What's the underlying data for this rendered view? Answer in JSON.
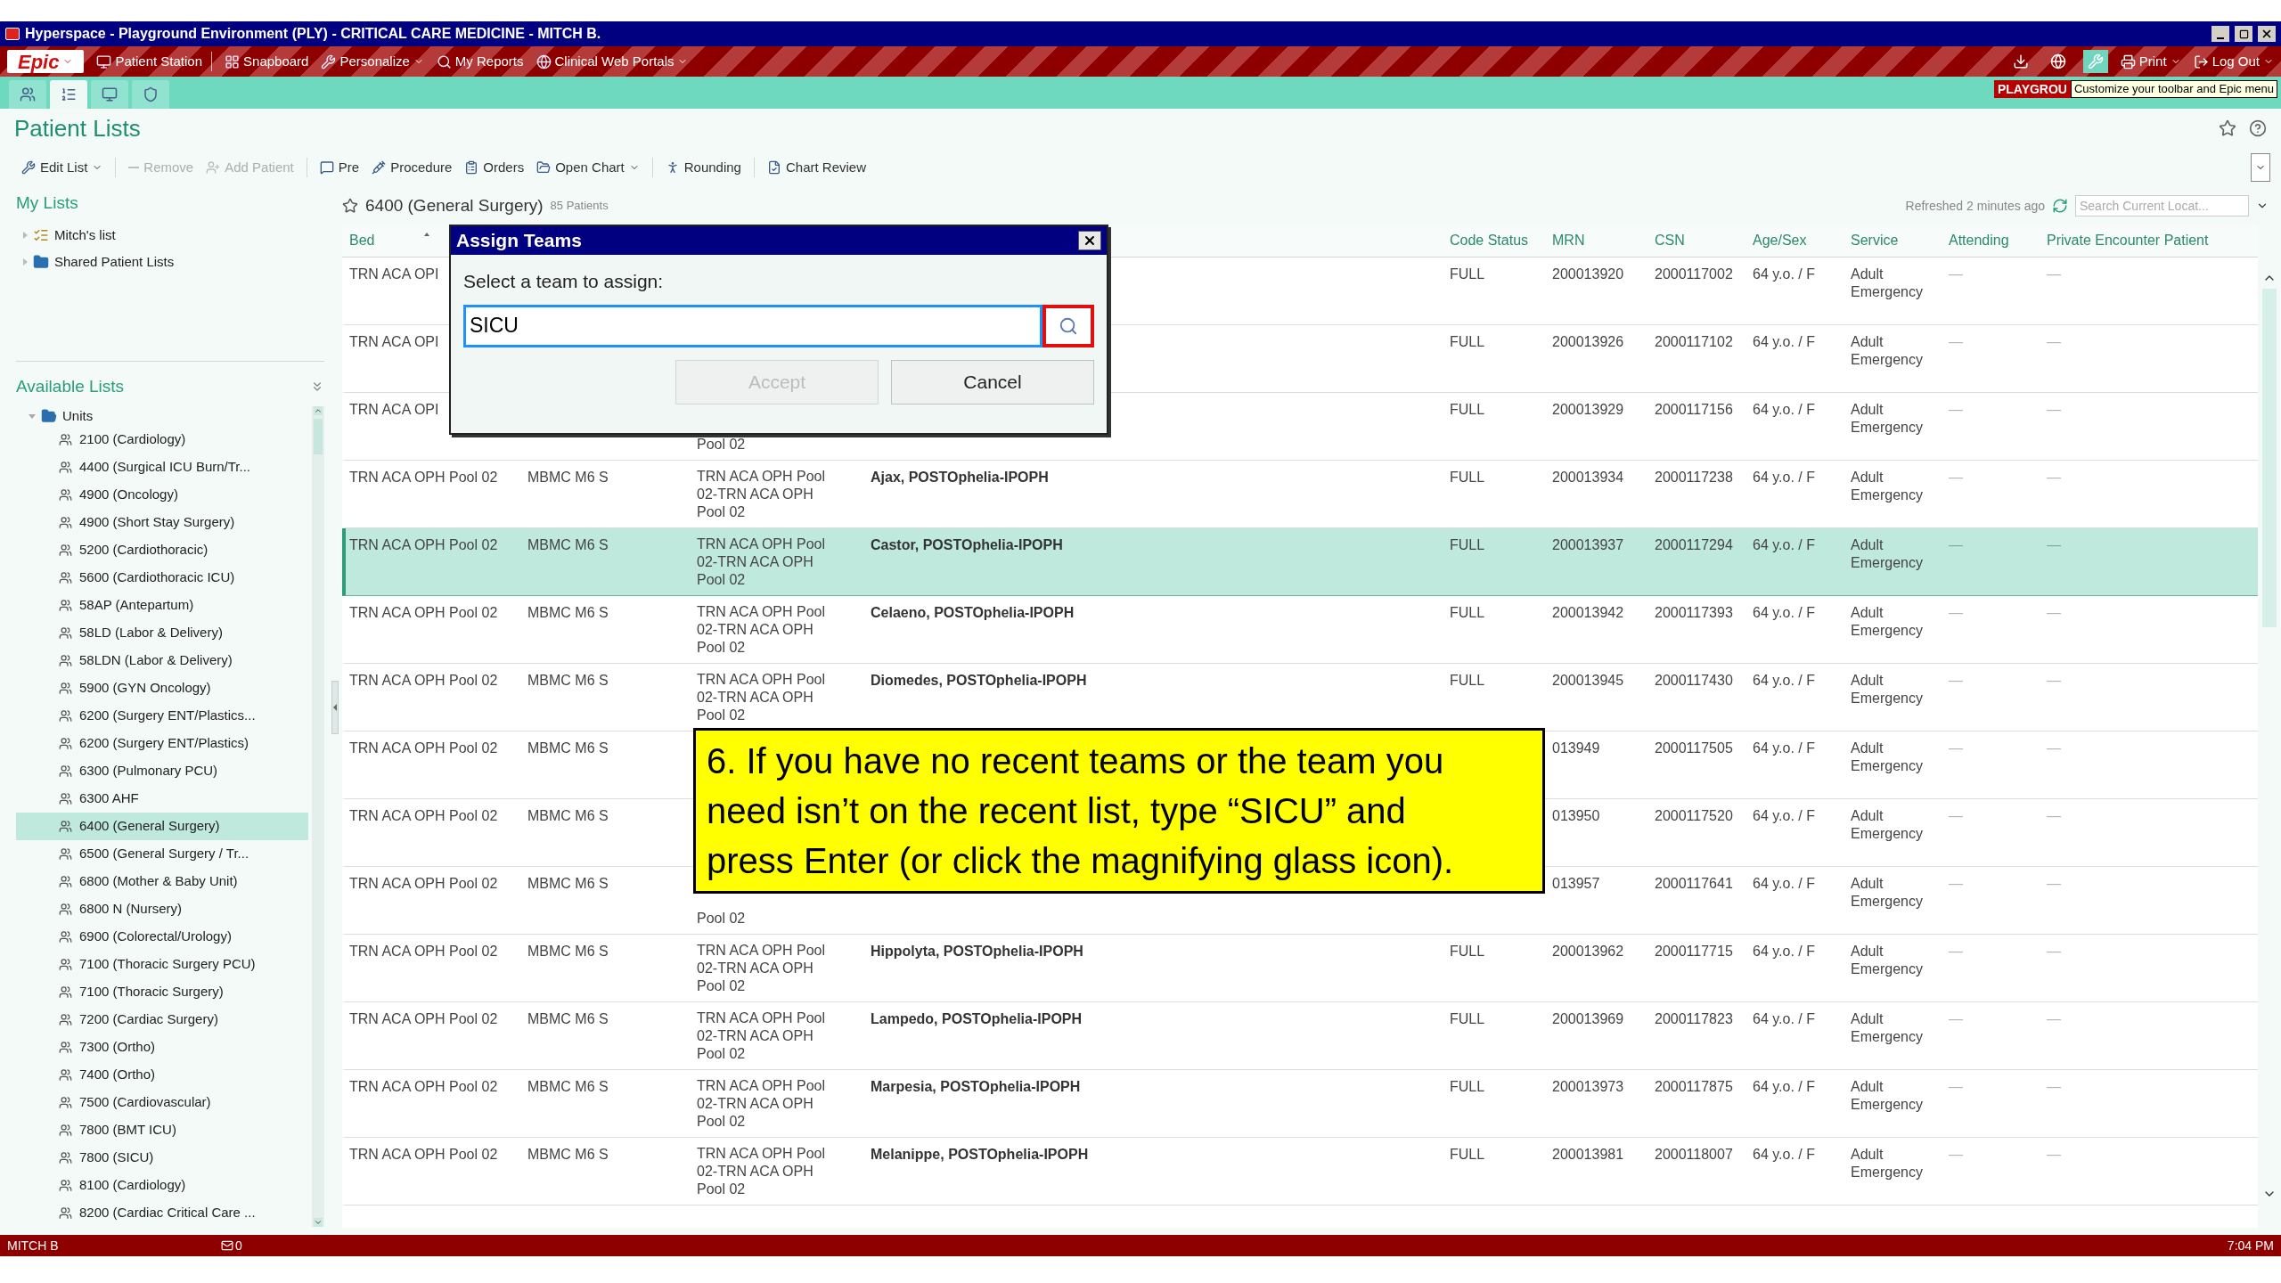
{
  "window": {
    "title": "Hyperspace - Playground Environment (PLY) - CRITICAL CARE MEDICINE - MITCH B."
  },
  "menu_bar": {
    "logo": "Epic",
    "items": [
      {
        "label": "Patient Station",
        "dropdown": false,
        "separator_after": true
      },
      {
        "label": "Snapboard",
        "dropdown": false,
        "separator_after": false
      },
      {
        "label": "Personalize",
        "dropdown": true,
        "separator_after": false
      },
      {
        "label": "My Reports",
        "dropdown": false,
        "separator_after": false
      },
      {
        "label": "Clinical Web Portals",
        "dropdown": true,
        "separator_after": false
      }
    ],
    "icon_buttons": [
      {
        "highlighted": false
      },
      {
        "highlighted": false
      },
      {
        "highlighted": true
      }
    ],
    "right_items": [
      {
        "label": "Print",
        "dropdown": true
      },
      {
        "label": "Log Out",
        "dropdown": true
      }
    ]
  },
  "activity_tabs": [
    {
      "selected": false
    },
    {
      "selected": true
    },
    {
      "selected": false
    },
    {
      "selected": false
    }
  ],
  "environment_badge": "PLAYGROU",
  "tooltip": "Customize your toolbar and Epic menu",
  "page_title": "Patient Lists",
  "toolbar": [
    {
      "label": "Edit List",
      "dropdown": true,
      "disabled": false,
      "separator_before": false
    },
    {
      "label": "Remove",
      "dropdown": false,
      "disabled": true,
      "separator_before": true
    },
    {
      "label": "Add Patient",
      "dropdown": false,
      "disabled": true,
      "separator_before": false
    },
    {
      "label": "Pre",
      "dropdown": false,
      "disabled": false,
      "separator_before": true
    },
    {
      "label": "Procedure",
      "dropdown": false,
      "disabled": false,
      "separator_before": false
    },
    {
      "label": "Orders",
      "dropdown": false,
      "disabled": false,
      "separator_before": false
    },
    {
      "label": "Open Chart",
      "dropdown": true,
      "disabled": false,
      "separator_before": false
    },
    {
      "label": "Rounding",
      "dropdown": false,
      "disabled": false,
      "separator_before": true
    },
    {
      "label": "Chart Review",
      "dropdown": false,
      "disabled": false,
      "separator_before": true
    }
  ],
  "sidebar": {
    "my_lists": {
      "title": "My Lists",
      "items": [
        {
          "label": "Mitch's list",
          "kind": "list",
          "expanded": false
        },
        {
          "label": "Shared Patient Lists",
          "kind": "folder",
          "expanded": false
        }
      ]
    },
    "available_lists": {
      "title": "Available Lists",
      "tree": [
        {
          "label": "Units",
          "expanded": true,
          "children": [
            {
              "label": "2100 (Cardiology)",
              "selected": false
            },
            {
              "label": "4400 (Surgical ICU Burn/Tr...",
              "selected": false
            },
            {
              "label": "4900 (Oncology)",
              "selected": false
            },
            {
              "label": "4900 (Short Stay Surgery)",
              "selected": false
            },
            {
              "label": "5200 (Cardiothoracic)",
              "selected": false
            },
            {
              "label": "5600 (Cardiothoracic ICU)",
              "selected": false
            },
            {
              "label": "58AP (Antepartum)",
              "selected": false
            },
            {
              "label": "58LD (Labor & Delivery)",
              "selected": false
            },
            {
              "label": "58LDN (Labor & Delivery)",
              "selected": false
            },
            {
              "label": "5900 (GYN Oncology)",
              "selected": false
            },
            {
              "label": "6200 (Surgery ENT/Plastics...",
              "selected": false
            },
            {
              "label": "6200 (Surgery ENT/Plastics)",
              "selected": false
            },
            {
              "label": "6300 (Pulmonary PCU)",
              "selected": false
            },
            {
              "label": "6300 AHF",
              "selected": false
            },
            {
              "label": "6400 (General Surgery)",
              "selected": true
            },
            {
              "label": "6500 (General Surgery / Tr...",
              "selected": false
            },
            {
              "label": "6800 (Mother & Baby Unit)",
              "selected": false
            },
            {
              "label": "6800 N (Nursery)",
              "selected": false
            },
            {
              "label": "6900 (Colorectal/Urology)",
              "selected": false
            },
            {
              "label": "7100 (Thoracic Surgery PCU)",
              "selected": false
            },
            {
              "label": "7100 (Thoracic Surgery)",
              "selected": false
            },
            {
              "label": "7200 (Cardiac Surgery)",
              "selected": false
            },
            {
              "label": "7300 (Ortho)",
              "selected": false
            },
            {
              "label": "7400 (Ortho)",
              "selected": false
            },
            {
              "label": "7500 (Cardiovascular)",
              "selected": false
            },
            {
              "label": "7800 (BMT ICU)",
              "selected": false
            },
            {
              "label": "7800 (SICU)",
              "selected": false
            },
            {
              "label": "8100 (Cardiology)",
              "selected": false
            },
            {
              "label": "8200 (Cardiac Critical Care ...",
              "selected": false
            }
          ]
        }
      ]
    }
  },
  "list_header": {
    "name": "6400 (General Surgery)",
    "count": "85 Patients",
    "refreshed": "Refreshed 2 minutes ago",
    "search_placeholder": "Search Current Locat..."
  },
  "table": {
    "columns": {
      "bed": "Bed",
      "code_status": "Code Status",
      "mrn": "MRN",
      "csn": "CSN",
      "age_sex": "Age/Sex",
      "service": "Service",
      "attending": "Attending",
      "private": "Private Encounter Patient"
    },
    "rows": [
      {
        "bed": "TRN ACA OPI",
        "code_status": "FULL",
        "mrn": "200013920",
        "csn": "2000117002",
        "age_sex": "64 y.o. / F",
        "service": "Adult Emergency",
        "attending": "—",
        "private": "—",
        "selected": false
      },
      {
        "bed": "TRN ACA OPI",
        "code_status": "FULL",
        "mrn": "200013926",
        "csn": "2000117102",
        "age_sex": "64 y.o. / F",
        "service": "Adult Emergency",
        "attending": "—",
        "private": "—",
        "selected": false
      },
      {
        "bed": "TRN ACA OPI",
        "column_3": "Pool 02",
        "code_status": "FULL",
        "mrn": "200013929",
        "csn": "2000117156",
        "age_sex": "64 y.o. / F",
        "service": "Adult Emergency",
        "attending": "—",
        "private": "—",
        "selected": false
      },
      {
        "bed": "TRN ACA OPH Pool 02",
        "column_2": "MBMC M6 S",
        "column_3": "TRN ACA OPH Pool 02-TRN ACA OPH Pool 02",
        "patient": "Ajax, POSTOphelia-IPOPH",
        "code_status": "FULL",
        "mrn": "200013934",
        "csn": "2000117238",
        "age_sex": "64 y.o. / F",
        "service": "Adult Emergency",
        "attending": "—",
        "private": "—",
        "selected": false
      },
      {
        "bed": "TRN ACA OPH Pool 02",
        "column_2": "MBMC M6 S",
        "column_3": "TRN ACA OPH Pool 02-TRN ACA OPH Pool 02",
        "patient": "Castor, POSTOphelia-IPOPH",
        "code_status": "FULL",
        "mrn": "200013937",
        "csn": "2000117294",
        "age_sex": "64 y.o. / F",
        "service": "Adult Emergency",
        "attending": "—",
        "private": "—",
        "selected": true
      },
      {
        "bed": "TRN ACA OPH Pool 02",
        "column_2": "MBMC M6 S",
        "column_3": "TRN ACA OPH Pool 02-TRN ACA OPH Pool 02",
        "patient": "Celaeno, POSTOphelia-IPOPH",
        "code_status": "FULL",
        "mrn": "200013942",
        "csn": "2000117393",
        "age_sex": "64 y.o. / F",
        "service": "Adult Emergency",
        "attending": "—",
        "private": "—",
        "selected": false
      },
      {
        "bed": "TRN ACA OPH Pool 02",
        "column_2": "MBMC M6 S",
        "column_3": "TRN ACA OPH Pool 02-TRN ACA OPH Pool 02",
        "patient": "Diomedes, POSTOphelia-IPOPH",
        "code_status": "FULL",
        "mrn": "200013945",
        "csn": "2000117430",
        "age_sex": "64 y.o. / F",
        "service": "Adult Emergency",
        "attending": "—",
        "private": "—",
        "selected": false
      },
      {
        "bed": "TRN ACA OPH Pool 02",
        "column_2": "MBMC M6 S",
        "mrn": "013949",
        "csn": "2000117505",
        "age_sex": "64 y.o. / F",
        "service": "Adult Emergency",
        "attending": "—",
        "private": "—",
        "selected": false
      },
      {
        "bed": "TRN ACA OPH Pool 02",
        "column_2": "MBMC M6 S",
        "mrn": "013950",
        "csn": "2000117520",
        "age_sex": "64 y.o. / F",
        "service": "Adult Emergency",
        "attending": "—",
        "private": "—",
        "selected": false
      },
      {
        "bed": "TRN ACA OPH Pool 02",
        "column_2": "MBMC M6 S",
        "column_3": "Pool 02",
        "mrn": "013957",
        "csn": "2000117641",
        "age_sex": "64 y.o. / F",
        "service": "Adult Emergency",
        "attending": "—",
        "private": "—",
        "selected": false
      },
      {
        "bed": "TRN ACA OPH Pool 02",
        "column_2": "MBMC M6 S",
        "column_3": "TRN ACA OPH Pool 02-TRN ACA OPH Pool 02",
        "patient": "Hippolyta, POSTOphelia-IPOPH",
        "code_status": "FULL",
        "mrn": "200013962",
        "csn": "2000117715",
        "age_sex": "64 y.o. / F",
        "service": "Adult Emergency",
        "attending": "—",
        "private": "—",
        "selected": false
      },
      {
        "bed": "TRN ACA OPH Pool 02",
        "column_2": "MBMC M6 S",
        "column_3": "TRN ACA OPH Pool 02-TRN ACA OPH Pool 02",
        "patient": "Lampedo, POSTOphelia-IPOPH",
        "code_status": "FULL",
        "mrn": "200013969",
        "csn": "2000117823",
        "age_sex": "64 y.o. / F",
        "service": "Adult Emergency",
        "attending": "—",
        "private": "—",
        "selected": false
      },
      {
        "bed": "TRN ACA OPH Pool 02",
        "column_2": "MBMC M6 S",
        "column_3": "TRN ACA OPH Pool 02-TRN ACA OPH Pool 02",
        "patient": "Marpesia, POSTOphelia-IPOPH",
        "code_status": "FULL",
        "mrn": "200013973",
        "csn": "2000117875",
        "age_sex": "64 y.o. / F",
        "service": "Adult Emergency",
        "attending": "—",
        "private": "—",
        "selected": false
      },
      {
        "bed": "TRN ACA OPH Pool 02",
        "column_2": "MBMC M6 S",
        "column_3": "TRN ACA OPH Pool 02-TRN ACA OPH Pool 02",
        "patient": "Melanippe, POSTOphelia-IPOPH",
        "code_status": "FULL",
        "mrn": "200013981",
        "csn": "2000118007",
        "age_sex": "64 y.o. / F",
        "service": "Adult Emergency",
        "attending": "—",
        "private": "—",
        "selected": false
      }
    ]
  },
  "dialog": {
    "title": "Assign Teams",
    "prompt": "Select a team to assign:",
    "value": "SICU",
    "buttons": [
      {
        "label": "Accept",
        "disabled": true
      },
      {
        "label": "Cancel",
        "disabled": false
      }
    ]
  },
  "callout": "6. If you have no recent teams or the team you need isn’t on the recent list, type “SICU” and press Enter (or click the magnifying glass icon).",
  "status_bar": {
    "user": "MITCH B",
    "messages": "0",
    "time": "7:04 PM"
  }
}
